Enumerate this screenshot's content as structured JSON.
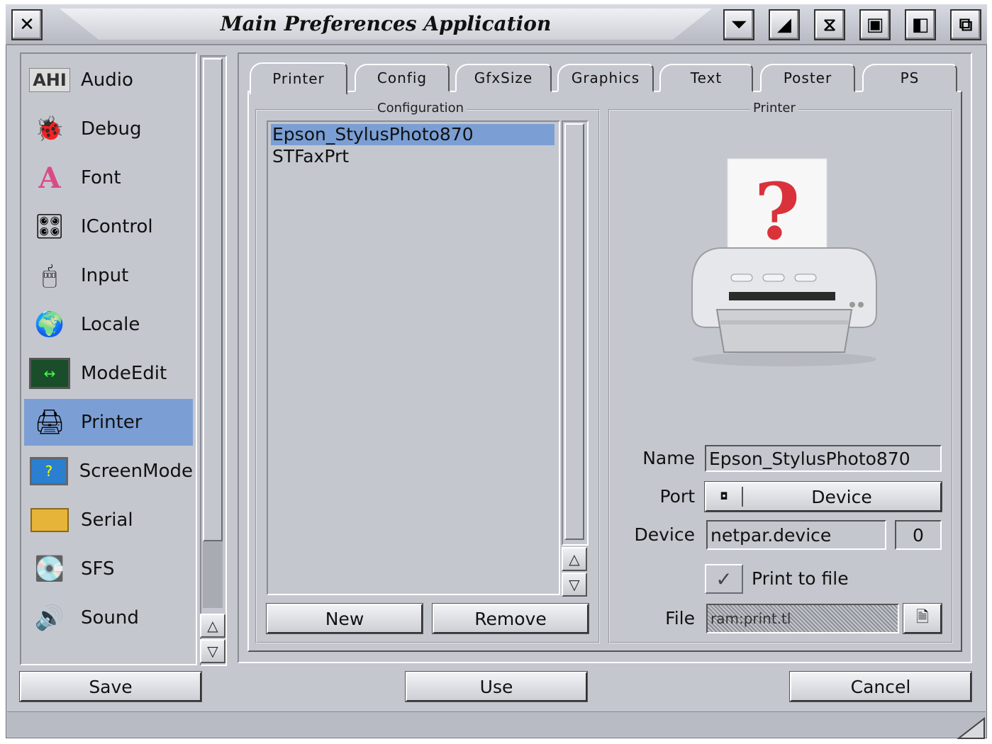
{
  "window": {
    "title": "Main Preferences Application",
    "title_buttons": [
      "close-icon",
      "depth-icon",
      "iconify-icon",
      "zoom-icon",
      "window-icon",
      "snapshot-icon",
      "jump-icon"
    ]
  },
  "sidebar": {
    "items": [
      {
        "label": "Audio",
        "icon": "ahi-icon"
      },
      {
        "label": "Debug",
        "icon": "bug-icon"
      },
      {
        "label": "Font",
        "icon": "font-icon"
      },
      {
        "label": "IControl",
        "icon": "icontrol-icon"
      },
      {
        "label": "Input",
        "icon": "mouse-icon"
      },
      {
        "label": "Locale",
        "icon": "globe-icon"
      },
      {
        "label": "ModeEdit",
        "icon": "monitor-icon"
      },
      {
        "label": "Printer",
        "icon": "printer-icon",
        "selected": true
      },
      {
        "label": "ScreenMode",
        "icon": "screen-icon"
      },
      {
        "label": "Serial",
        "icon": "serial-icon"
      },
      {
        "label": "SFS",
        "icon": "disk-icon"
      },
      {
        "label": "Sound",
        "icon": "speaker-icon"
      }
    ]
  },
  "tabs": [
    {
      "label": "Printer",
      "active": true
    },
    {
      "label": "Config"
    },
    {
      "label": "GfxSize"
    },
    {
      "label": "Graphics"
    },
    {
      "label": "Text"
    },
    {
      "label": "Poster"
    },
    {
      "label": "PS"
    }
  ],
  "configuration": {
    "group_title": "Configuration",
    "entries": [
      "Epson_StylusPhoto870",
      "STFaxPrt"
    ],
    "selected": "Epson_StylusPhoto870",
    "new_label": "New",
    "remove_label": "Remove"
  },
  "printer": {
    "group_title": "Printer",
    "name_label": "Name",
    "name_value": "Epson_StylusPhoto870",
    "port_label": "Port",
    "port_value": "Device",
    "device_label": "Device",
    "device_value": "netpar.device",
    "unit_value": "0",
    "print_to_file_label": "Print to file",
    "print_to_file_checked": true,
    "file_label": "File",
    "file_value": "ram:print.tl"
  },
  "footer": {
    "save_label": "Save",
    "use_label": "Use",
    "cancel_label": "Cancel"
  }
}
